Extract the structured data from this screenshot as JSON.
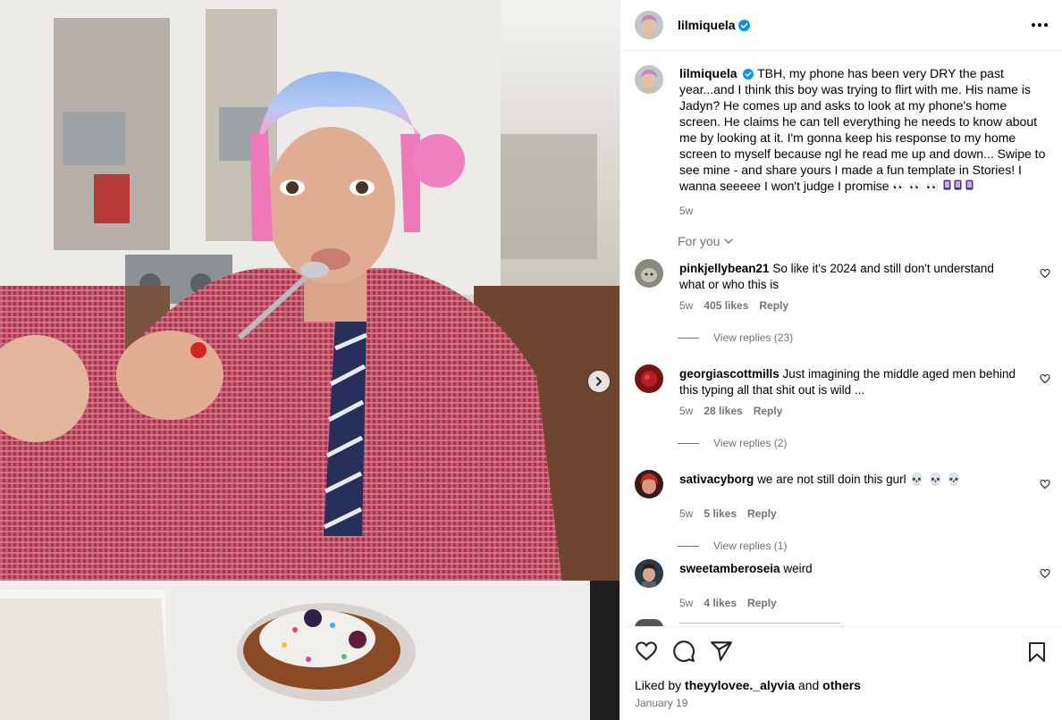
{
  "post": {
    "username": "lilmiquela",
    "caption": "TBH, my phone has been very DRY the past year...and I think this boy was trying to flirt with me. His name is Jadyn? He comes up and asks to look at my phone's home screen. He claims he can tell everything he needs to know about me by looking at it. I'm gonna keep his response to my home screen to myself because ngl he read me up and down... Swipe to see mine - and share yours I made a fun template in Stories! I wanna seeeee I won't judge I promise",
    "caption_emojis": "👀 👀 👀",
    "caption_age": "5w",
    "for_you_label": "For you"
  },
  "comments": [
    {
      "username": "pinkjellybean21",
      "text": "So like it's 2024 and still don't understand what or who this is",
      "age": "5w",
      "likes": "405 likes",
      "reply_label": "Reply",
      "view_replies": "View replies (23)",
      "avatar_color": "#8a8a80"
    },
    {
      "username": "georgiascottmills",
      "text": "Just imagining the middle aged men behind this typing all that shit out is wild ...",
      "age": "5w",
      "likes": "28 likes",
      "reply_label": "Reply",
      "view_replies": "View replies (2)",
      "avatar_color": "#7a1212"
    },
    {
      "username": "sativacyborg",
      "text": "we are not still doin this gurl",
      "text_emojis": "💀 💀 💀",
      "age": "5w",
      "likes": "5 likes",
      "reply_label": "Reply",
      "view_replies": "View replies (1)",
      "avatar_color": "#b53a2a"
    },
    {
      "username": "sweetamberoseia",
      "text": "weird",
      "age": "5w",
      "likes": "4 likes",
      "reply_label": "Reply",
      "avatar_color": "#2c3a48"
    }
  ],
  "footer": {
    "liked_by_prefix": "Liked by",
    "liked_by_user": "theyylovee._alyvia",
    "liked_by_and": "and",
    "liked_by_others": "others",
    "date": "January 19"
  },
  "colors": {
    "verified": "#0095f6",
    "muted": "#737373",
    "border": "#efefef"
  }
}
